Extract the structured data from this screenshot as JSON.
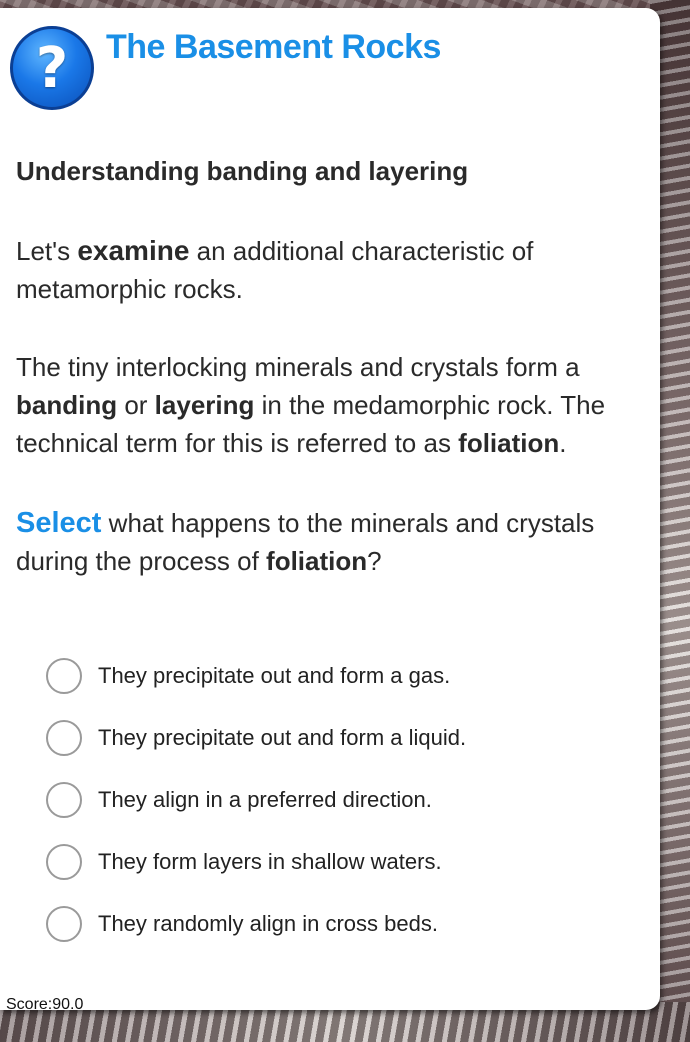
{
  "header": {
    "title": "The Basement Rocks",
    "help_icon": "question-icon",
    "help_glyph": "?"
  },
  "lesson": {
    "subheading": "Understanding banding and layering",
    "para1": {
      "t1": "Let's ",
      "b1": "examine",
      "t2": " an additional characteristic of metamorphic rocks."
    },
    "para2": {
      "t1": "The tiny interlocking minerals and crystals form a ",
      "b1": "banding",
      "t2": " or ",
      "b2": "layering",
      "t3": " in the medamorphic rock. The technical term for this is referred to as ",
      "b3": "foliation",
      "t4": "."
    },
    "para3": {
      "select": "Select",
      "t1": " what happens to the minerals and crystals during the process of ",
      "b1": "foliation",
      "t2": "?"
    }
  },
  "options": [
    {
      "label": "They precipitate out and form a gas."
    },
    {
      "label": "They precipitate out and form a liquid."
    },
    {
      "label": "They align in a preferred direction."
    },
    {
      "label": "They form layers in shallow waters."
    },
    {
      "label": "They randomly align in cross beds."
    }
  ],
  "footer": {
    "score": "Score:90.0"
  },
  "colors": {
    "accent": "#1a8fe6",
    "text": "#2a2a2a"
  }
}
